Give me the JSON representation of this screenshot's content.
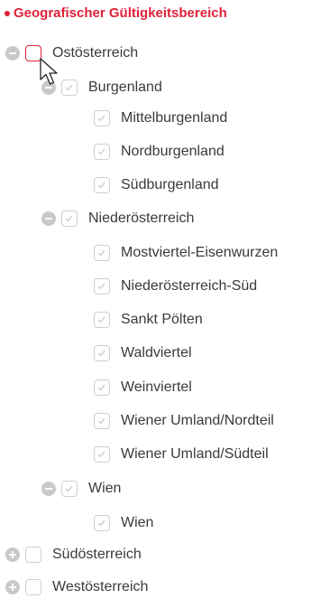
{
  "section_title": "Geografischer Gültigkeitsbereich",
  "tree": [
    {
      "label": "Ostösterreich"
    },
    {
      "label": "Burgenland"
    },
    {
      "label": "Mittelburgenland"
    },
    {
      "label": "Nordburgenland"
    },
    {
      "label": "Südburgenland"
    },
    {
      "label": "Niederösterreich"
    },
    {
      "label": "Mostviertel-Eisenwurzen"
    },
    {
      "label": "Niederösterreich-Süd"
    },
    {
      "label": "Sankt Pölten"
    },
    {
      "label": "Waldviertel"
    },
    {
      "label": "Weinviertel"
    },
    {
      "label": "Wiener Umland/Nordteil"
    },
    {
      "label": "Wiener Umland/Südteil"
    },
    {
      "label": "Wien"
    },
    {
      "label": "Wien"
    },
    {
      "label": "Südösterreich"
    },
    {
      "label": "Westösterreich"
    }
  ],
  "colors": {
    "accent": "#e0213a",
    "toggle": "#c9c9c9",
    "checkbox_border": "#cfcfcf"
  }
}
